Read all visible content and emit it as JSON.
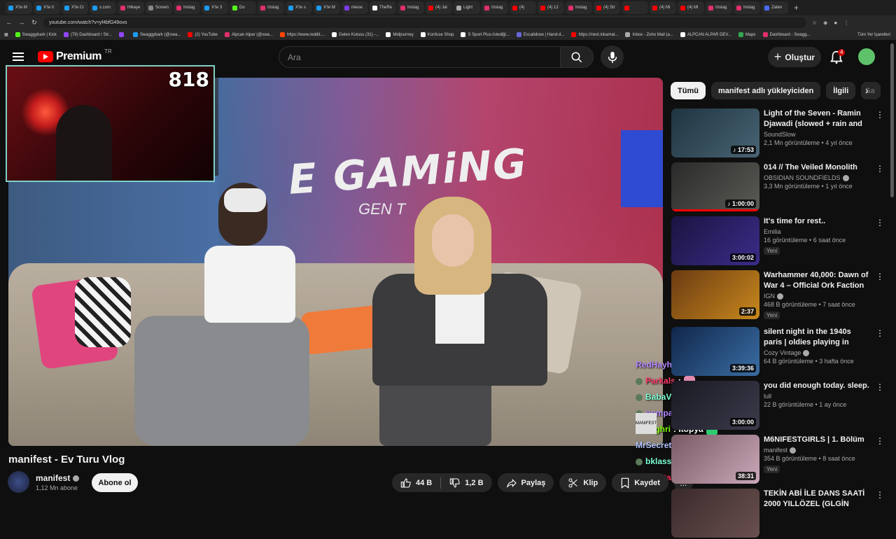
{
  "browser": {
    "tabs": [
      {
        "label": "X'te M",
        "color": "#1d9bf0"
      },
      {
        "label": "X'te Il",
        "color": "#1d9bf0"
      },
      {
        "label": "X'te Cr",
        "color": "#1d9bf0"
      },
      {
        "label": "x.com",
        "color": "#1d9bf0"
      },
      {
        "label": "Hikaye",
        "color": "#e1306c"
      },
      {
        "label": "Screen",
        "color": "#888888"
      },
      {
        "label": "Instag",
        "color": "#e1306c"
      },
      {
        "label": "X'te 3",
        "color": "#1d9bf0"
      },
      {
        "label": "Do",
        "color": "#53fc18"
      },
      {
        "label": "Instag",
        "color": "#e1306c"
      },
      {
        "label": "X'te s",
        "color": "#1d9bf0"
      },
      {
        "label": "X'te M",
        "color": "#1d9bf0"
      },
      {
        "label": "nieuw",
        "color": "#7c3aed"
      },
      {
        "label": "TheRe",
        "color": "#ffffff"
      },
      {
        "label": "Instag",
        "color": "#e1306c"
      },
      {
        "label": "(4) Jal",
        "color": "#ff0000"
      },
      {
        "label": "Light",
        "color": "#aaaaaa"
      },
      {
        "label": "Instag",
        "color": "#e1306c"
      },
      {
        "label": "(4)",
        "color": "#ff0000"
      },
      {
        "label": "(4) 12",
        "color": "#ff0000"
      },
      {
        "label": "Instag",
        "color": "#e1306c"
      },
      {
        "label": "(4) Str",
        "color": "#ff0000"
      },
      {
        "label": "",
        "color": "#ff0000"
      },
      {
        "label": "(4) Mi",
        "color": "#ff0000"
      },
      {
        "label": "(4) Mi",
        "color": "#ff0000"
      },
      {
        "label": "Instag",
        "color": "#e1306c"
      },
      {
        "label": "Instag",
        "color": "#e1306c"
      },
      {
        "label": "Zaten",
        "color": "#4a6cf7"
      }
    ],
    "new_tab": "+",
    "url": "youtube.com/watch?v=yf4bfG49ovo",
    "bookmarks": [
      {
        "label": "Swaggybark | Kick",
        "color": "#53fc18"
      },
      {
        "label": "(79) Dashboard / Str...",
        "color": "#9146ff"
      },
      {
        "label": "",
        "color": "#9146ff"
      },
      {
        "label": "Swaggybark (@swa...",
        "color": "#1d9bf0"
      },
      {
        "label": "(2) YouTube",
        "color": "#ff0000"
      },
      {
        "label": "Alpcan Alpar (@swa...",
        "color": "#e1306c"
      },
      {
        "label": "https://www.reddit....",
        "color": "#ff4500"
      },
      {
        "label": "Gelen Kutusu (31) -...",
        "color": "#ffffff"
      },
      {
        "label": "Midjourney",
        "color": "#ffffff"
      },
      {
        "label": "Konfuse Shop",
        "color": "#ffffff"
      },
      {
        "label": "S Sport Plus-İstediği...",
        "color": "#ffffff"
      },
      {
        "label": "Excalidraw | Hand-d...",
        "color": "#6965db"
      },
      {
        "label": "https://next.inkamat...",
        "color": "#ff0000"
      },
      {
        "label": "Inbox - Zoho Mail (a...",
        "color": "#aaaaaa"
      },
      {
        "label": "ALPCAN ALPAR DEV...",
        "color": "#ffffff"
      },
      {
        "label": "Maps",
        "color": "#34a853"
      },
      {
        "label": "Dashboard - Swagg...",
        "color": "#e1306c"
      }
    ],
    "all_bookmarks": "Tüm Yer İşaretleri"
  },
  "header": {
    "logo_word": "Premium",
    "logo_sup": "TR",
    "search_placeholder": "Ara",
    "create_label": "Oluştur",
    "notif_count": "4"
  },
  "video": {
    "graffiti": "E GAMiNG",
    "graffiti_sub": "GEN T",
    "cam_count": "818",
    "title": "manifest - Ev Turu Vlog",
    "channel": "manifest",
    "subs": "1,12 Mn abone",
    "subscribe": "Abone ol",
    "likes": "44 B",
    "dislikes": "1,2 B",
    "share": "Paylaş",
    "clip": "Klip",
    "save": "Kaydet",
    "more": "...",
    "badge": "MANIFEST"
  },
  "chat": [
    {
      "user": "RedHayha",
      "msg": "",
      "color": "#b388ff",
      "emote": "#c0392b"
    },
    {
      "user": "Parkals",
      "msg": ":",
      "color": "#ff3b6a",
      "emote": "#e08ab0"
    },
    {
      "user": "BabaVangaa",
      "msg": ":",
      "color": "#7fffd4",
      "emote": "#6cc644"
    },
    {
      "user": "pompaberat",
      "msg": ":",
      "color": "#b388ff",
      "emote": "#6cc644"
    },
    {
      "user": "caghri",
      "msg": ": İtopya",
      "color": "#7fff00",
      "emote": "#2ecc71"
    },
    {
      "user": "MrSecret",
      "msg": "",
      "color": "#b0c4ff",
      "emote": ""
    },
    {
      "user": "bklasse",
      "msg": "",
      "color": "#7fffd4",
      "emote": "#6cc644"
    },
    {
      "user": "Kajutanastin_imlecodin",
      "msg": "",
      "color": "#ff2d55",
      "emote": ""
    }
  ],
  "sidebar": {
    "chips": [
      {
        "label": "Tümü",
        "active": true
      },
      {
        "label": "manifest adlı yükleyiciden",
        "active": false
      },
      {
        "label": "İlgili",
        "active": false
      },
      {
        "label": "Sa",
        "active": false
      }
    ],
    "recs": [
      {
        "title": "Light of the Seven - Ramin Djawadi (slowed + rain and ...",
        "channel": "SoundSlow",
        "verified": false,
        "meta": "2,1 Mn görüntüleme • 4 yıl önce",
        "badge": "",
        "duration": "♪ 17:53",
        "bg": "linear-gradient(135deg,#1e3440,#4a6474)",
        "progress": 0
      },
      {
        "title": "014 // The Veiled Monolith",
        "channel": "OBSIDIAN SOUNDFIELDS",
        "verified": true,
        "meta": "3,3 Mn görüntüleme • 1 yıl önce",
        "badge": "",
        "duration": "♪ 1:00:00",
        "bg": "linear-gradient(135deg,#2a2a2a,#5a5a55)",
        "progress": 100
      },
      {
        "title": "It's time for rest..",
        "channel": "Emilia",
        "verified": false,
        "meta": "16 görüntüleme • 6 saat önce",
        "badge": "Yeni",
        "duration": "3:00:02",
        "bg": "linear-gradient(135deg,#1a1440,#3b2c8a)",
        "progress": 0
      },
      {
        "title": "Warhammer 40,000: Dawn of War 4 – Official Ork Faction ...",
        "channel": "IGN",
        "verified": true,
        "meta": "468 B görüntüleme • 7 saat önce",
        "badge": "Yeni",
        "duration": "2:37",
        "bg": "linear-gradient(135deg,#6b3a12,#c8891d)",
        "progress": 0
      },
      {
        "title": "silent night in the 1940s paris | oldies playing in another room...",
        "channel": "Cozy Vintage",
        "verified": true,
        "meta": "64 B görüntüleme • 3 hafta önce",
        "badge": "",
        "duration": "3:39:36",
        "bg": "linear-gradient(135deg,#10264a,#3a6ea5)",
        "progress": 0
      },
      {
        "title": "you did enough today. sleep.",
        "channel": "lull",
        "verified": false,
        "meta": "22 B görüntüleme • 1 ay önce",
        "badge": "",
        "duration": "3:00:00",
        "bg": "linear-gradient(135deg,#1a1a24,#3a3a4a)",
        "progress": 0
      },
      {
        "title": "M6NIFESTGIRLS | 1. Bölüm",
        "channel": "manifest",
        "verified": true,
        "meta": "354 B görüntüleme • 8 saat önce",
        "badge": "Yeni",
        "duration": "38:31",
        "bg": "linear-gradient(135deg,#7a5a66,#caa8b8)",
        "progress": 0
      },
      {
        "title": "TEKİN ABİ İLE DANS SAATİ 2000 YILLÖZEL (GLGİN",
        "channel": "",
        "verified": false,
        "meta": "",
        "badge": "",
        "duration": "",
        "bg": "linear-gradient(135deg,#3a2a2a,#6a5050)",
        "progress": 0
      }
    ]
  }
}
